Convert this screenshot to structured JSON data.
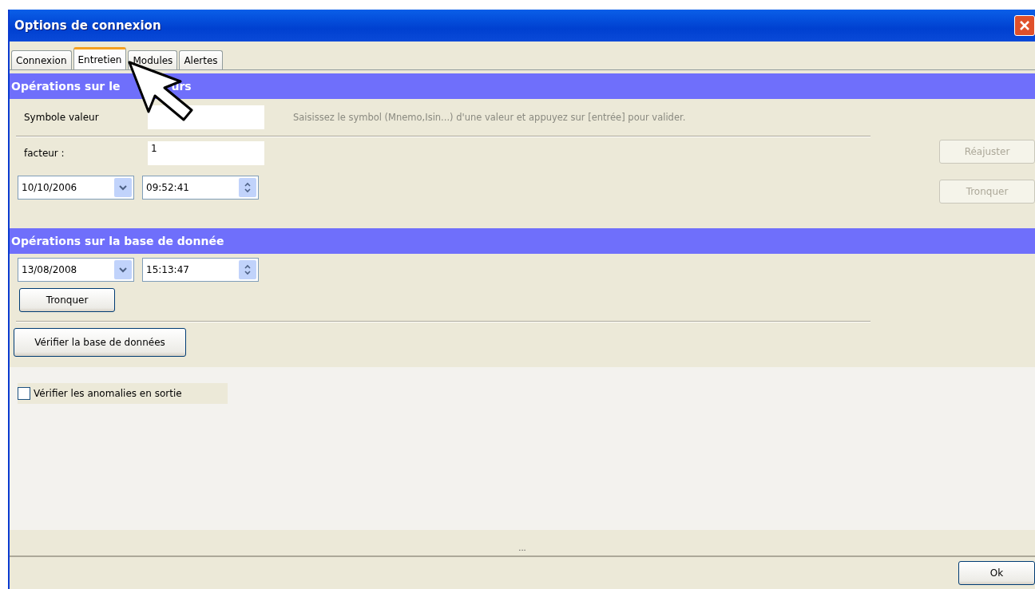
{
  "window": {
    "title": "Options de connexion"
  },
  "tabs": [
    {
      "label": "Connexion",
      "selected": false
    },
    {
      "label": "Entretien",
      "selected": true
    },
    {
      "label": "Modules",
      "selected": false
    },
    {
      "label": "Alertes",
      "selected": false
    }
  ],
  "values_section": {
    "title_parts": [
      "Opérations sur le",
      "urs"
    ],
    "symbol": {
      "label": "Symbole valeur"
    },
    "hint": "Saisissez le symbol (Mnemo,Isin...) d'une valeur et appuyez sur [entrée] pour valider.",
    "factor": {
      "label": "facteur :",
      "value": "1"
    },
    "date": "10/10/2006",
    "time": "09:52:41",
    "buttons": [
      {
        "label": "Réajuster",
        "disabled": true
      },
      {
        "label": "Tronquer",
        "disabled": true
      }
    ]
  },
  "database_section": {
    "title": "Opérations sur la base de donnée",
    "date": "13/08/2008",
    "time": "15:13:47",
    "buttons": [
      {
        "label": "Tronquer",
        "disabled": false
      },
      {
        "label": "Vérifier la base de données",
        "disabled": false
      }
    ]
  },
  "exit_check": {
    "label": "Vérifier les anomalies en sortie",
    "checked": false
  },
  "status_bar": "...",
  "ok_button": "Ok"
}
